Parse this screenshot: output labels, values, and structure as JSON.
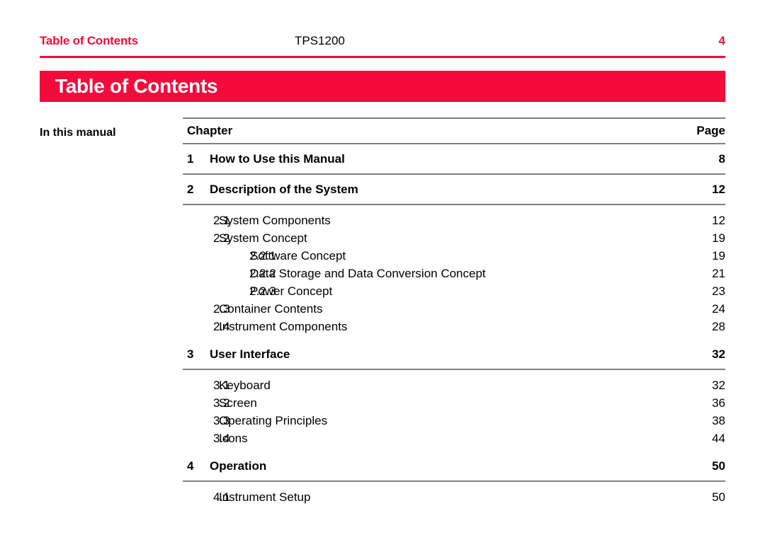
{
  "header": {
    "left_title": "Table of Contents",
    "product": "TPS1200",
    "page_number": "4"
  },
  "banner": {
    "title": "Table of Contents"
  },
  "margin": {
    "label": "In this manual"
  },
  "colors": {
    "brand_red": "#f50a3c",
    "rule_gray": "#808080",
    "text": "#000000"
  },
  "toc": {
    "columns": {
      "chapter": "Chapter",
      "page": "Page"
    },
    "entries": [
      {
        "level": 1,
        "number": "1",
        "title": "How to Use this Manual",
        "page": "8"
      },
      {
        "level": 1,
        "number": "2",
        "title": "Description of the System",
        "page": "12"
      },
      {
        "level": 2,
        "number": "2.1",
        "title": "System Components",
        "page": "12"
      },
      {
        "level": 2,
        "number": "2.2",
        "title": "System Concept",
        "page": "19"
      },
      {
        "level": 3,
        "number": "2.2.1",
        "title": "Software Concept",
        "page": "19"
      },
      {
        "level": 3,
        "number": "2.2.2",
        "title": "Data Storage and Data Conversion Concept",
        "page": "21"
      },
      {
        "level": 3,
        "number": "2.2.3",
        "title": "Power Concept",
        "page": "23"
      },
      {
        "level": 2,
        "number": "2.3",
        "title": "Container Contents",
        "page": "24"
      },
      {
        "level": 2,
        "number": "2.4",
        "title": "Instrument Components",
        "page": "28"
      },
      {
        "level": 1,
        "number": "3",
        "title": "User Interface",
        "page": "32"
      },
      {
        "level": 2,
        "number": "3.1",
        "title": "Keyboard",
        "page": "32"
      },
      {
        "level": 2,
        "number": "3.2",
        "title": "Screen",
        "page": "36"
      },
      {
        "level": 2,
        "number": "3.3",
        "title": "Operating Principles",
        "page": "38"
      },
      {
        "level": 2,
        "number": "3.4",
        "title": "Icons",
        "page": "44"
      },
      {
        "level": 1,
        "number": "4",
        "title": "Operation",
        "page": "50"
      },
      {
        "level": 2,
        "number": "4.1",
        "title": "Instrument Setup",
        "page": "50"
      }
    ]
  }
}
